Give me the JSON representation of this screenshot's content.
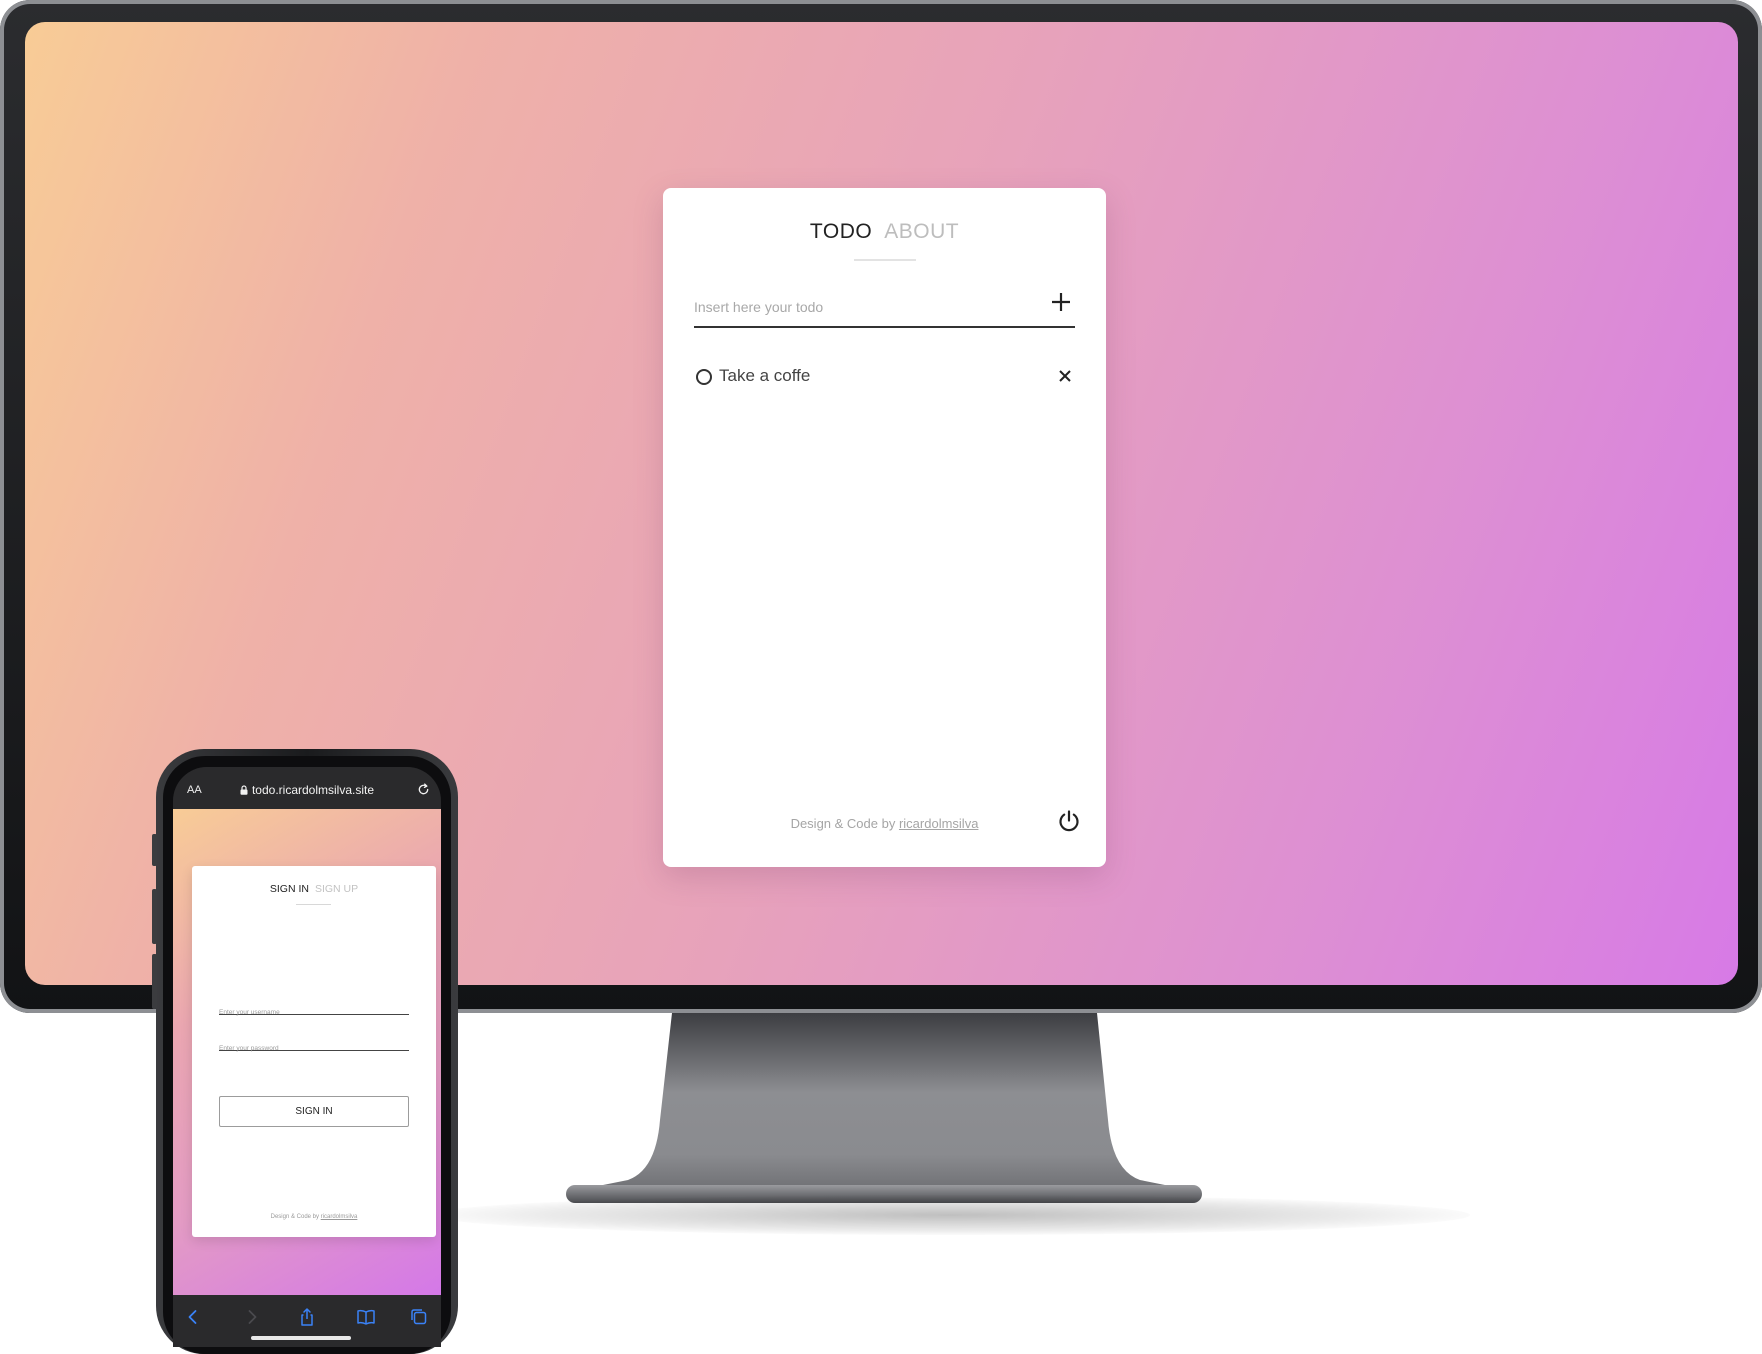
{
  "desktop_app": {
    "tabs": [
      {
        "label": "TODO",
        "active": true
      },
      {
        "label": "ABOUT",
        "active": false
      }
    ],
    "input": {
      "placeholder": "Insert here your todo",
      "value": ""
    },
    "add_icon": "plus-icon",
    "todos": [
      {
        "label": "Take a coffe",
        "completed": false
      }
    ],
    "footer": {
      "prefix": "Design & Code by ",
      "author": "ricardolmsilva"
    },
    "power_icon": "power-icon"
  },
  "phone_browser": {
    "text_size_label": "AA",
    "url": "todo.ricardolmsilva.site",
    "toolbar_icons": [
      "back-icon",
      "forward-icon",
      "share-icon",
      "bookmarks-icon",
      "tabs-icon"
    ]
  },
  "phone_app": {
    "tabs": [
      {
        "label": "SIGN IN",
        "active": true
      },
      {
        "label": "SIGN UP",
        "active": false
      }
    ],
    "username_placeholder": "Enter your username",
    "password_placeholder": "Enter your password",
    "signin_button": "SIGN IN",
    "footer": {
      "prefix": "Design & Code by ",
      "author": "ricardolmsilva"
    }
  },
  "colors": {
    "gradient_start": "#f8cc96",
    "gradient_end": "#d77ae6",
    "card_bg": "#ffffff",
    "text_primary": "#222222",
    "text_muted": "#bdbdbd",
    "ios_link_blue": "#3a82f7"
  }
}
